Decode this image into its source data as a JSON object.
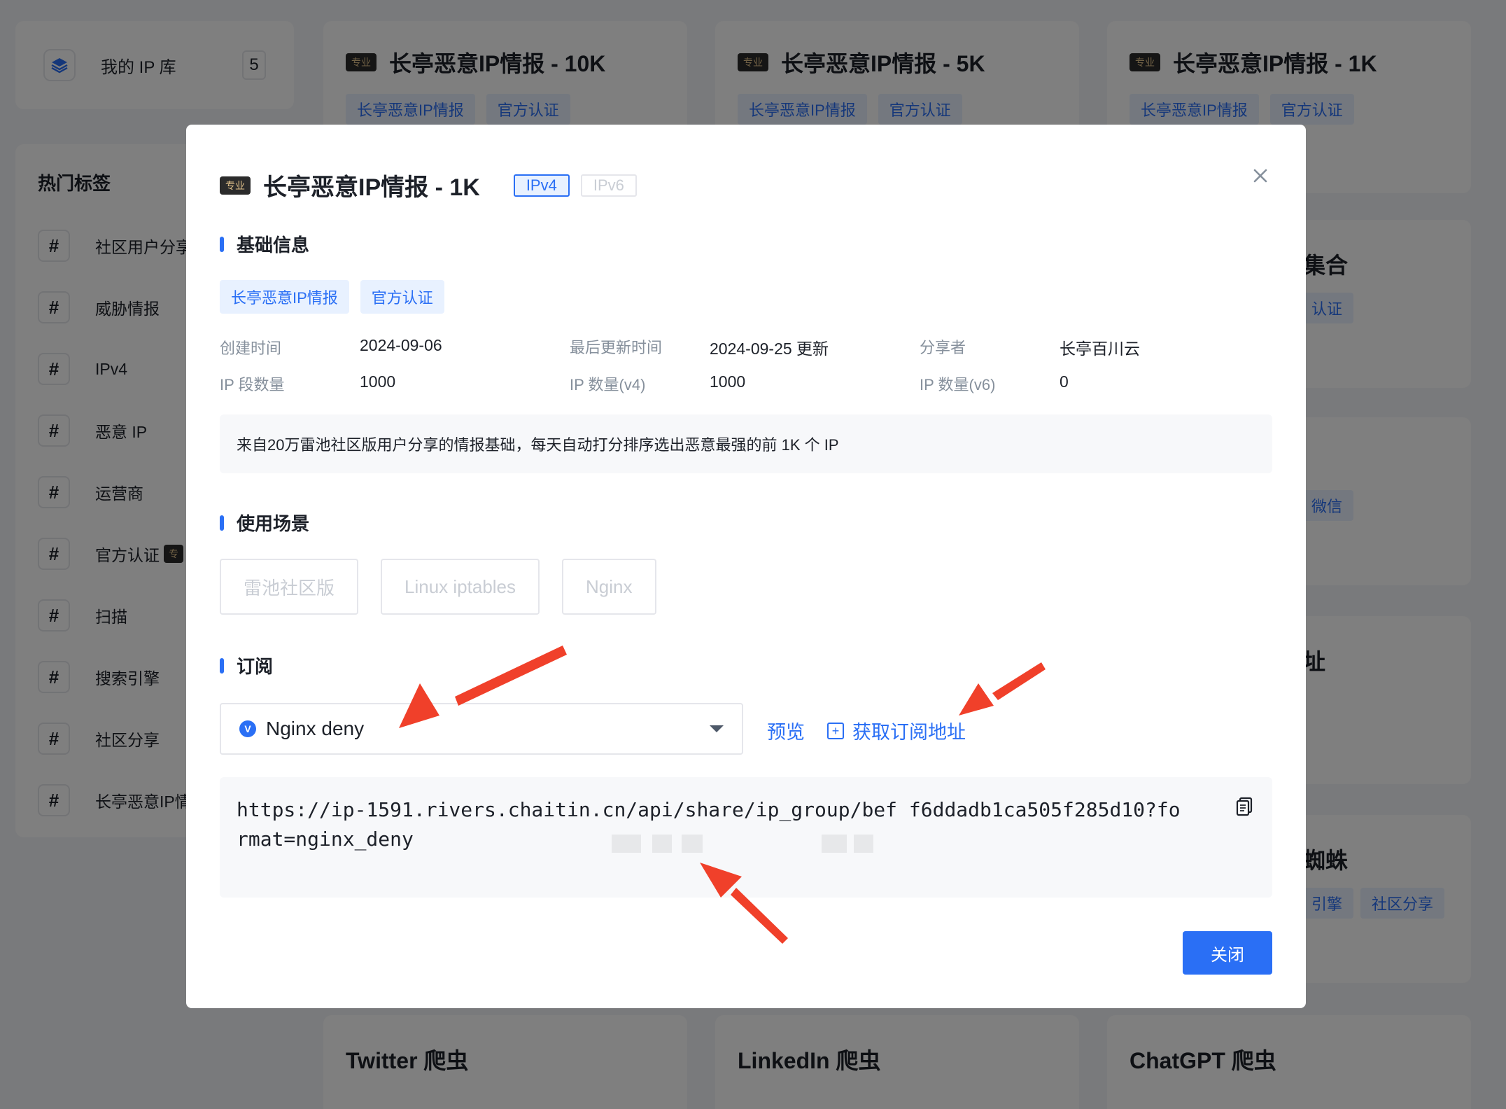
{
  "background": {
    "ip_library": {
      "label": "我的 IP 库",
      "count": "5"
    },
    "top_cards": [
      {
        "title": "长亭恶意IP情报 - 10K",
        "badge": "专业",
        "tags": [
          "长亭恶意IP情报",
          "官方认证"
        ]
      },
      {
        "title": "长亭恶意IP情报 - 5K",
        "badge": "专业",
        "tags": [
          "长亭恶意IP情报",
          "官方认证"
        ]
      },
      {
        "title": "长亭恶意IP情报 - 1K",
        "badge": "专业",
        "tags": [
          "长亭恶意IP情报",
          "官方认证"
        ]
      }
    ],
    "hot_tags": {
      "title": "热门标签",
      "items": [
        "社区用户分享",
        "威胁情报",
        "IPv4",
        "恶意 IP",
        "运营商",
        "官方认证",
        "扫描",
        "搜索引擎",
        "社区分享",
        "长亭恶意IP情报"
      ],
      "badge": "专"
    },
    "right_fragments": {
      "t1": "集合",
      "tag1": "认证",
      "tag2": "微信",
      "t3": "址",
      "t4": "蜘蛛",
      "tag4a": "引擎",
      "tag4b": "社区分享"
    },
    "bottom_cards": [
      "Twitter 爬虫",
      "LinkedIn 爬虫",
      "ChatGPT 爬虫"
    ]
  },
  "modal": {
    "badge": "专业",
    "title": "长亭恶意IP情报 - 1K",
    "versions": [
      "IPv4",
      "IPv6"
    ],
    "sections": {
      "basic": "基础信息",
      "scenarios": "使用场景",
      "subscribe": "订阅"
    },
    "tags": [
      "长亭恶意IP情报",
      "官方认证"
    ],
    "info": [
      [
        {
          "k": "创建时间",
          "v": "2024-09-06"
        },
        {
          "k": "最后更新时间",
          "v": "2024-09-25 更新"
        },
        {
          "k": "分享者",
          "v": "长亭百川云"
        }
      ],
      [
        {
          "k": "IP 段数量",
          "v": "1000"
        },
        {
          "k": "IP 数量(v4)",
          "v": "1000"
        },
        {
          "k": "IP 数量(v6)",
          "v": "0"
        }
      ]
    ],
    "description": "来自20万雷池社区版用户分享的情报基础，每天自动打分排序选出恶意最强的前 1K 个 IP",
    "scenario_buttons": [
      "雷池社区版",
      "Linux iptables",
      "Nginx"
    ],
    "subscribe_select": {
      "icon_letter": "V",
      "value": "Nginx deny"
    },
    "preview_label": "预览",
    "get_url_label": "获取订阅地址",
    "url": "https://ip-1591.rivers.chaitin.cn/api/share/ip_group/bef          f6ddadb1ca505f285d10?format=nginx_deny",
    "close_label": "关闭"
  },
  "colors": {
    "accent": "#2a6ff5",
    "arrow": "#f0402a",
    "overlay": "rgba(0,0,0,0.5)"
  }
}
